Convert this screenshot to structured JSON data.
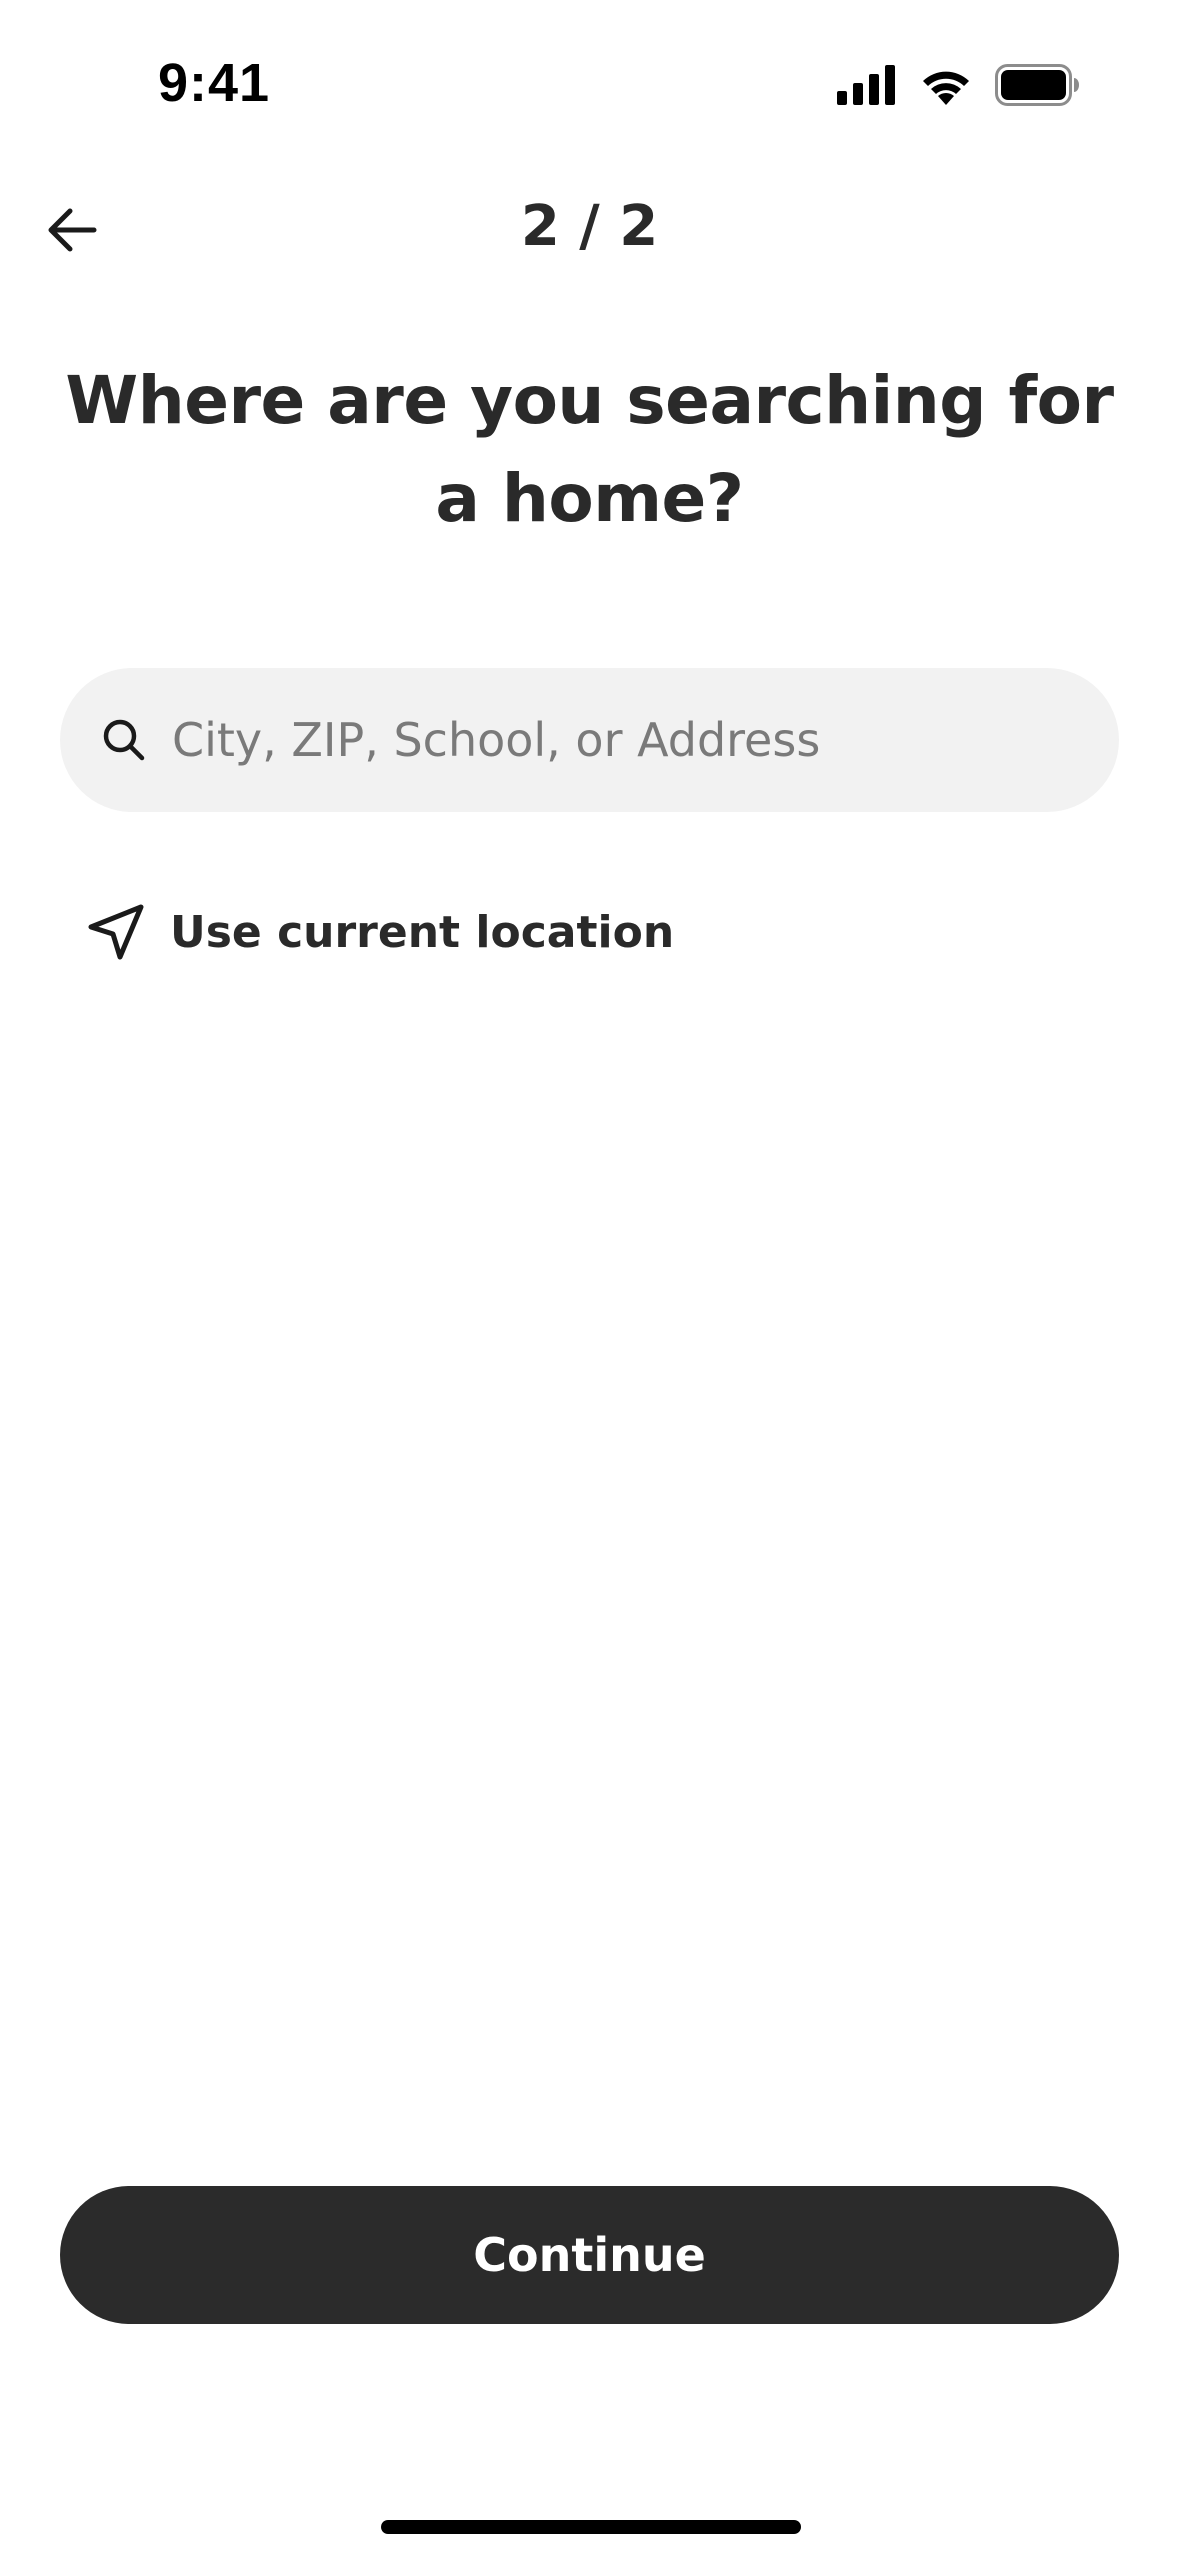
{
  "status_bar": {
    "time": "9:41",
    "icons": [
      "cellular-signal-icon",
      "wifi-icon",
      "battery-icon"
    ]
  },
  "header": {
    "back_icon": "arrow-left-icon",
    "step": "2 / 2"
  },
  "title": {
    "line1": "Where are you searching for",
    "line2": "a home?"
  },
  "search": {
    "icon": "search-icon",
    "placeholder": "City, ZIP, School, or Address",
    "value": ""
  },
  "location": {
    "icon": "navigation-arrow-icon",
    "label": "Use current location"
  },
  "footer": {
    "continue_label": "Continue"
  },
  "colors": {
    "text": "#2a2a2a",
    "search_bg": "#f2f2f2",
    "placeholder": "#7a7a7a",
    "button_bg": "#2b2b2b",
    "button_text": "#ffffff"
  }
}
